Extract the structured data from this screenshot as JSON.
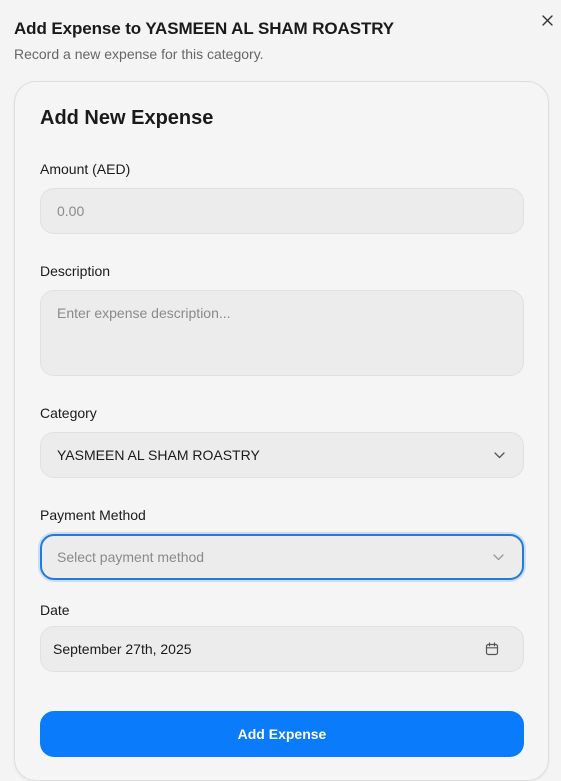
{
  "dialog": {
    "title": "Add Expense to YASMEEN AL SHAM ROASTRY",
    "subtitle": "Record a new expense for this category.",
    "close_icon": "close-icon"
  },
  "form": {
    "title": "Add New Expense",
    "amount": {
      "label": "Amount (AED)",
      "placeholder": "0.00",
      "value": ""
    },
    "description": {
      "label": "Description",
      "placeholder": "Enter expense description...",
      "value": ""
    },
    "category": {
      "label": "Category",
      "value": "YASMEEN AL SHAM ROASTRY",
      "icon": "chevron-down-icon"
    },
    "payment_method": {
      "label": "Payment Method",
      "placeholder": "Select payment method",
      "icon": "chevron-down-icon"
    },
    "date": {
      "label": "Date",
      "value": "September 27th, 2025",
      "icon": "calendar-icon"
    },
    "submit_label": "Add Expense"
  },
  "colors": {
    "accent": "#0a7bfa",
    "focus_ring": "#1f7be0",
    "background": "#f4f4f4",
    "field_bg": "#ececec"
  }
}
